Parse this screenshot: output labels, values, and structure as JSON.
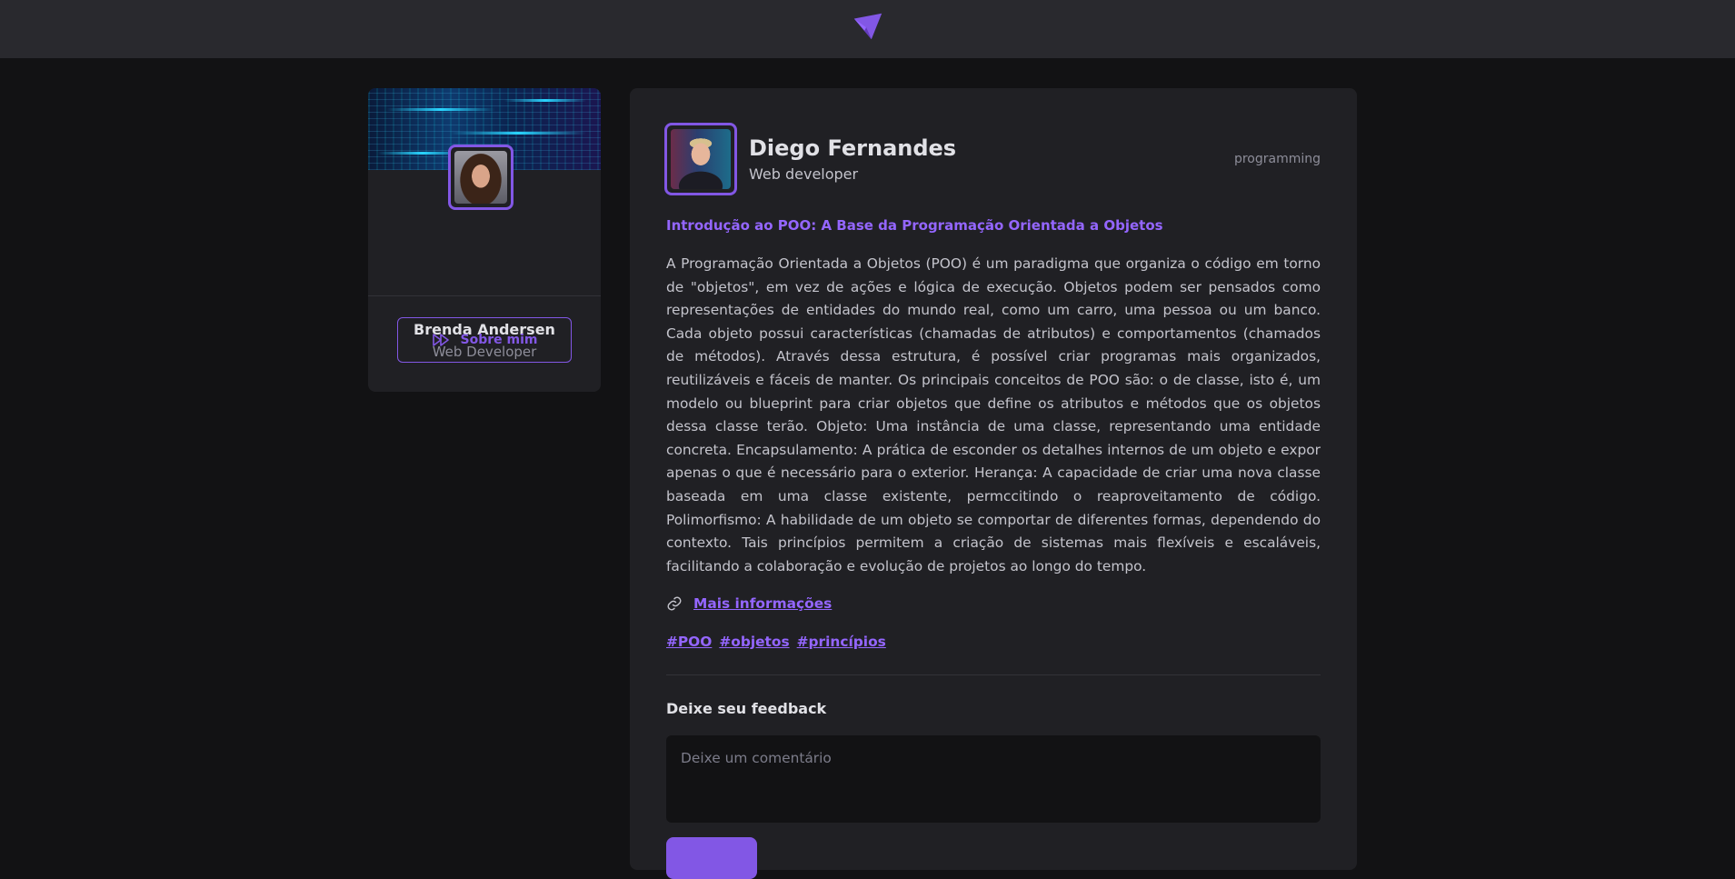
{
  "header": {
    "logo_icon": "ignite-logo-icon",
    "accent": "#8257e5"
  },
  "sidebar": {
    "name": "Brenda Andersen",
    "role": "Web Developer",
    "button_label": "Sobre mim",
    "button_icon": "fast-forward-icon"
  },
  "post": {
    "author_name": "Diego Fernandes",
    "author_role": "Web developer",
    "category": "programming",
    "title": "Introdução ao POO: A Base da Programação Orientada a Objetos",
    "body": "A Programação Orientada a Objetos (POO) é um paradigma que organiza o código em torno de \"objetos\", em vez de ações e lógica de execução. Objetos podem ser pensados como representações de entidades do mundo real, como um carro, uma pessoa ou um banco. Cada objeto possui características (chamadas de atributos) e comportamentos (chamados de métodos). Através dessa estrutura, é possível criar programas mais organizados, reutilizáveis e fáceis de manter. Os principais conceitos de POO são: o de classe, isto é, um modelo ou blueprint para criar objetos que define os atributos e métodos que os objetos dessa classe terão. Objeto: Uma instância de uma classe, representando uma entidade concreta. Encapsulamento: A prática de esconder os detalhes internos de um objeto e expor apenas o que é necessário para o exterior. Herança: A capacidade de criar uma nova classe baseada em uma classe existente, permccitindo o reaproveitamento de código. Polimorfismo: A habilidade de um objeto se comportar de diferentes formas, dependendo do contexto. Tais princípios permitem a criação de sistemas mais flexíveis e escaláveis, facilitando a colaboração e evolução de projetos ao longo do tempo.",
    "link_label": "Mais informações",
    "link_icon": "link-icon",
    "tags": [
      "#POO",
      "#objetos",
      "#princípios"
    ]
  },
  "feedback": {
    "title": "Deixe seu feedback",
    "placeholder": "Deixe um comentário"
  }
}
